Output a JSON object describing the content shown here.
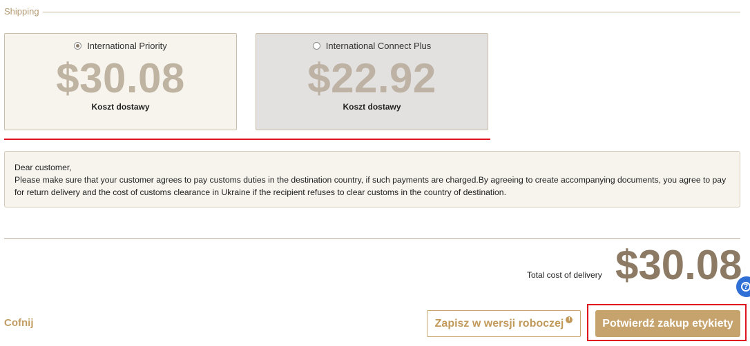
{
  "section": {
    "title": "Shipping"
  },
  "options": [
    {
      "name": "International Priority",
      "price": "$30.08",
      "caption": "Koszt dostawy",
      "selected": true
    },
    {
      "name": "International Connect Plus",
      "price": "$22.92",
      "caption": "Koszt dostawy",
      "selected": false
    }
  ],
  "notice": {
    "greeting": "Dear customer,",
    "body": "Please make sure that your customer agrees to pay customs duties in the destination country, if such payments are charged.By agreeing to create accompanying documents, you agree to pay for return delivery and the cost of customs clearance in Ukraine if the recipient refuses to clear customs in the country of destination."
  },
  "total": {
    "label": "Total cost of delivery",
    "value": "$30.08"
  },
  "actions": {
    "back_label": "Cofnij",
    "draft_label": "Zapisz w wersji roboczej",
    "draft_badge": "!",
    "confirm_label": "Potwierdź zakup etykiety"
  },
  "help": {
    "icon": "question-icon",
    "glyph": "?"
  },
  "colors": {
    "accent": "#c6a36c",
    "price_muted": "#bfb3a2",
    "total_price": "#8c7a64",
    "highlight_red": "#e0141e",
    "help_blue": "#2f6fd6"
  }
}
